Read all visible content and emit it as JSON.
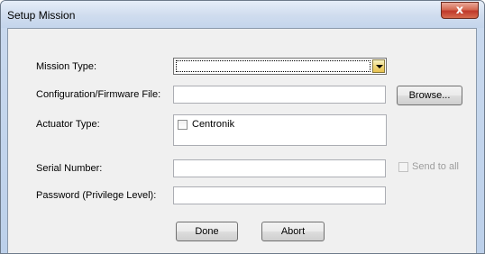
{
  "window": {
    "title": "Setup Mission",
    "close_symbol": "x"
  },
  "form": {
    "mission_type_label": "Mission Type:",
    "mission_type_value": "",
    "config_label": "Configuration/Firmware File:",
    "config_value": "",
    "browse_label": "Browse...",
    "actuator_label": "Actuator Type:",
    "actuator_items": [
      {
        "label": "Centronik",
        "checked": false
      }
    ],
    "serial_label": "Serial Number:",
    "serial_value": "",
    "send_to_all_label": "Send to all",
    "password_label": "Password (Privilege Level):",
    "password_value": ""
  },
  "buttons": {
    "done": "Done",
    "abort": "Abort"
  },
  "icons": {
    "close": "close-icon",
    "dropdown": "chevron-down-icon",
    "checkbox": "checkbox-icon"
  },
  "colors": {
    "close_button": "#c0392b",
    "dialog_background": "#f0f0f0",
    "disabled_text": "#9d9d9d"
  }
}
